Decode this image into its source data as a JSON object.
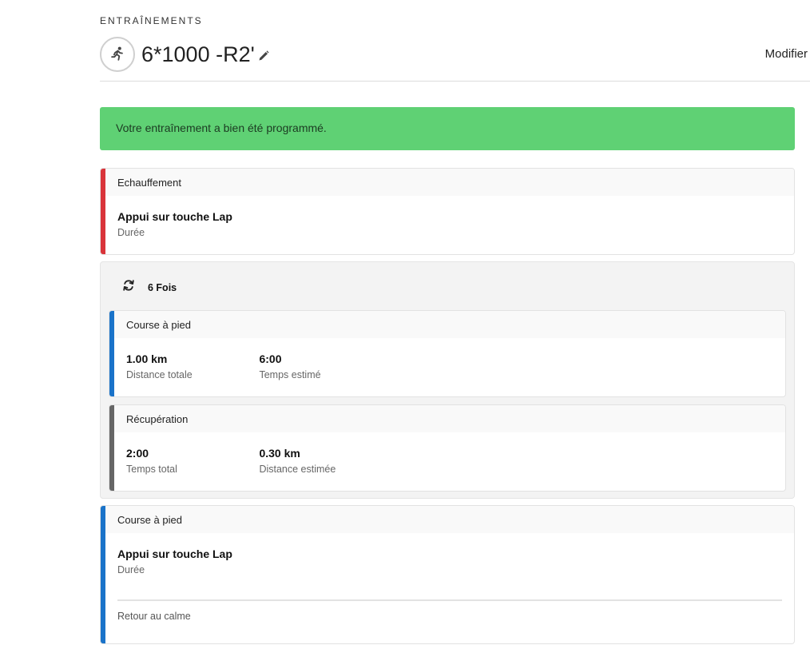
{
  "breadcrumb": "ENTRAÎNEMENTS",
  "header": {
    "title": "6*1000 -R2'",
    "sport_icon": "running-person-icon",
    "edit_icon": "pencil-icon",
    "modify_label": "Modifier"
  },
  "alert": {
    "message": "Votre entraînement a bien été programmé.",
    "color": "#5fd174"
  },
  "colors": {
    "warmup": "#d9343a",
    "run": "#1a73c9",
    "recovery": "#666666"
  },
  "steps": {
    "warmup": {
      "type": "Echauffement",
      "value": "Appui sur touche Lap",
      "label": "Durée"
    },
    "repeat": {
      "icon": "repeat-icon",
      "count_label": "6 Fois",
      "run": {
        "type": "Course à pied",
        "metric1_value": "1.00 km",
        "metric1_label": "Distance totale",
        "metric2_value": "6:00",
        "metric2_label": "Temps estimé"
      },
      "recovery": {
        "type": "Récupération",
        "metric1_value": "2:00",
        "metric1_label": "Temps total",
        "metric2_value": "0.30 km",
        "metric2_label": "Distance estimée"
      }
    },
    "cooldown": {
      "type": "Course à pied",
      "value": "Appui sur touche Lap",
      "label": "Durée",
      "note": "Retour au calme"
    }
  }
}
